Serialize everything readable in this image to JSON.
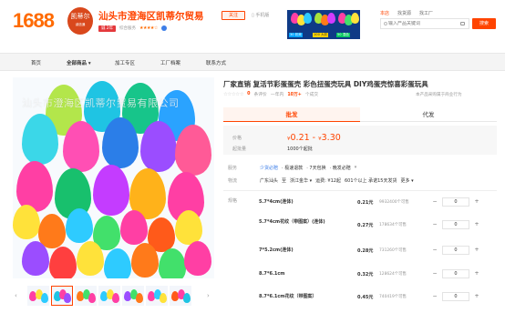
{
  "header": {
    "logo": "1688",
    "avatar_main": "凯蒂尔",
    "avatar_sub": "诚信通",
    "shop_name": "汕头市澄海区凯蒂尔贸易",
    "chengxin_badge": "诚 2年",
    "trust_text": "综合服务",
    "stars": "★★★★☆",
    "follow_label": "关注",
    "phone_label": "手机版",
    "banner_labels": [
      "30 彩壳",
      "100 大彩",
      "50 混色"
    ],
    "search_scopes": [
      "本店",
      "找货源",
      "找工厂"
    ],
    "search_placeholder": "输入产品关键词",
    "search_button": "搜索"
  },
  "nav": {
    "items": [
      "首页",
      "全部商品",
      "加工专区",
      "工厂档案",
      "联系方式"
    ]
  },
  "gallery": {
    "watermark": "汕头市澄海区凯蒂尔贸易有限公司",
    "prev_arrow": "‹",
    "next_arrow": "›"
  },
  "product": {
    "title": "厂家直销 复活节彩蛋蛋壳 彩色扭蛋壳玩具 DIY鸡蛋壳惊喜彩蛋玩具",
    "rating_stars": "☆☆☆☆☆",
    "rating_value": "0",
    "rating_label": "条评价",
    "sold_label": "一年内",
    "sold_value": "10万+",
    "sold_unit": "个成交",
    "supplier_link": "本产品采购属于商业行为",
    "tabs": [
      "批发",
      "代发"
    ],
    "price_label": "价格",
    "price_from": "0.21",
    "price_to": "3.30",
    "yen": "¥",
    "moq_label": "起批量",
    "moq_value": "1000个起批",
    "service_label": "服务",
    "service_items": [
      "少货必赔",
      "· 极速退款",
      "· 7天包换",
      "· 晚发必赔"
    ],
    "shipping_label": "物流",
    "shipping_items": [
      "广东汕头",
      "至",
      "浙江金华",
      "运费: ¥12起",
      "601个以上 承诺15天发货",
      "更多"
    ],
    "sku_label": "规格",
    "skus": [
      {
        "name": "5.7*4cm(连体)",
        "price": "0.21元",
        "stock": "9932400个可售",
        "qty": "0"
      },
      {
        "name": "5.7*4cm花纹（带图案）(连体)",
        "price": "0.27元",
        "stock": "178634个可售",
        "qty": "0"
      },
      {
        "name": "7*5.2cm(连体)",
        "price": "0.28元",
        "stock": "731260个可售",
        "qty": "0"
      },
      {
        "name": "8.7*6.1cm",
        "price": "0.32元",
        "stock": "128624个可售",
        "qty": "0"
      },
      {
        "name": "8.7*6.1cm花纹（带图案）",
        "price": "0.45元",
        "stock": "740419个可售",
        "qty": "0"
      }
    ],
    "minus": "−",
    "plus": "+"
  }
}
